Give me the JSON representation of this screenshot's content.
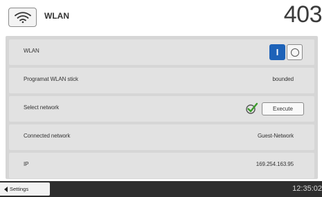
{
  "header": {
    "title": "WLAN",
    "number": "403",
    "wifi_icon": "wifi-icon"
  },
  "rows": [
    {
      "label": "WLAN",
      "toggle": {
        "on_label": "I",
        "state": "on"
      }
    },
    {
      "label": "Programat WLAN stick",
      "value": "bounded"
    },
    {
      "label": "Select network",
      "status_icon": "check-icon",
      "button_label": "Execute"
    },
    {
      "label": "Connected network",
      "value": "Guest-Network"
    },
    {
      "label": "IP",
      "value": "169.254.163.95"
    }
  ],
  "footer": {
    "back_label": "Settings",
    "time": "12:35:02"
  },
  "colors": {
    "accent": "#1d62b8",
    "check": "#3a9a2a",
    "panel": "#d6d6d6",
    "footer": "#2e2e2e"
  }
}
